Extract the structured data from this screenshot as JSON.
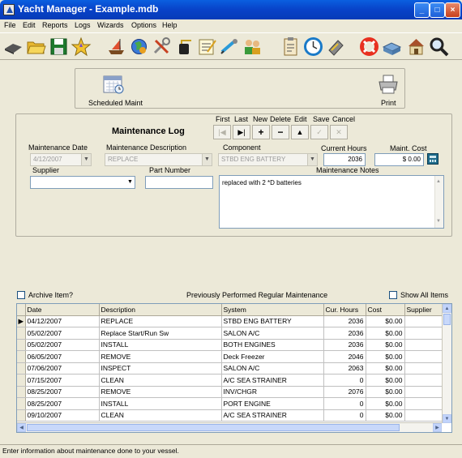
{
  "window": {
    "title": "Yacht Manager - Example.mdb"
  },
  "menu": [
    "File",
    "Edit",
    "Reports",
    "Logs",
    "Wizards",
    "Options",
    "Help"
  ],
  "toolbar_icons": [
    "print-setup-icon",
    "open-folder-icon",
    "save-disk-icon",
    "favorites-icon",
    "boat-icon",
    "globe-icon",
    "tools-icon",
    "maintenance-icon",
    "notes-icon",
    "pump-icon",
    "people-icon",
    "checklist-icon",
    "clock-icon",
    "fuel-icon",
    "life-ring-icon",
    "inventory-icon",
    "marina-icon",
    "search-icon"
  ],
  "actions": {
    "scheduled_label": "Scheduled Maint",
    "print_label": "Print"
  },
  "form": {
    "title": "Maintenance Log",
    "nav_labels": [
      "First",
      "Last",
      "New",
      "Delete",
      "Edit",
      "Save",
      "Cancel"
    ],
    "date_label": "Maintenance Date",
    "date_value": "4/12/2007",
    "description_label": "Maintenance Description",
    "description_value": "REPLACE",
    "component_label": "Component",
    "component_value": "STBD ENG BATTERY",
    "hours_label": "Current Hours",
    "hours_value": "2036",
    "cost_label": "Maint. Cost",
    "cost_value": "$ 0.00",
    "supplier_label": "Supplier",
    "supplier_value": "",
    "part_label": "Part Number",
    "part_value": "",
    "notes_label": "Maintenance Notes",
    "notes_value": "replaced with 2 *D batteries"
  },
  "options": {
    "archive_label": "Archive Item?",
    "archive_checked": false,
    "grid_caption": "Previously Performed Regular Maintenance",
    "show_all_label": "Show All Items",
    "show_all_checked": false
  },
  "grid": {
    "columns": [
      "Date",
      "Description",
      "System",
      "Cur. Hours",
      "Cost",
      "Supplier"
    ],
    "rows": [
      [
        "04/12/2007",
        "REPLACE",
        "STBD ENG BATTERY",
        "2036",
        "$0.00",
        ""
      ],
      [
        "05/02/2007",
        "Replace Start/Run Sw",
        "SALON A/C",
        "2036",
        "$0.00",
        ""
      ],
      [
        "05/02/2007",
        "INSTALL",
        "BOTH ENGINES",
        "2036",
        "$0.00",
        ""
      ],
      [
        "06/05/2007",
        "REMOVE",
        "Deck Freezer",
        "2046",
        "$0.00",
        ""
      ],
      [
        "07/06/2007",
        "INSPECT",
        "SALON A/C",
        "2063",
        "$0.00",
        ""
      ],
      [
        "07/15/2007",
        "CLEAN",
        "A/C SEA STRAINER",
        "0",
        "$0.00",
        ""
      ],
      [
        "08/25/2007",
        "REMOVE",
        "INV/CHGR",
        "2076",
        "$0.00",
        ""
      ],
      [
        "08/25/2007",
        "INSTALL",
        "PORT ENGINE",
        "0",
        "$0.00",
        ""
      ],
      [
        "09/10/2007",
        "CLEAN",
        "A/C SEA STRAINER",
        "0",
        "$0.00",
        ""
      ]
    ]
  },
  "status": "Enter information about maintenance done to your vessel."
}
